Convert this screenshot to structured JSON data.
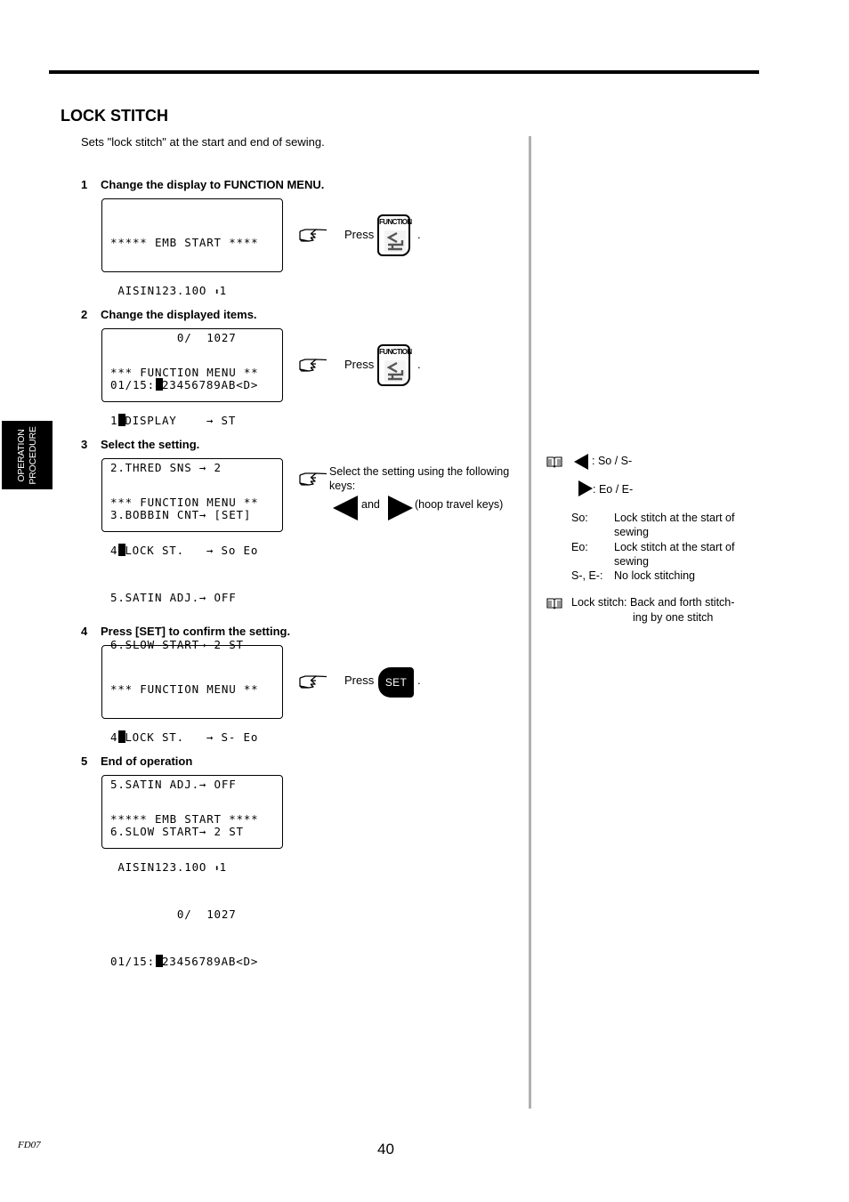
{
  "page": {
    "title": "LOCK STITCH",
    "intro": "Sets \"lock stitch\" at the start and end of sewing.",
    "side_tab": [
      "OPERATION",
      "PROCEDURE"
    ],
    "footer_code": "FD07",
    "page_number": "40"
  },
  "steps": [
    {
      "num": "1",
      "heading": "Change the display to FUNCTION MENU.",
      "lcd": {
        "line1": "***** EMB START ****",
        "line2_pre": " AISIN123.10O ",
        "line2_icon": "⬍",
        "line2_post": "1",
        "line3": "         0/  1027",
        "line4_pre": "01/15:",
        "line4_post": "23456789AB<D>"
      },
      "action_text": "Press",
      "key": "FUNCTION",
      "dot": "."
    },
    {
      "num": "2",
      "heading": "Change the displayed items.",
      "lcd": {
        "line1": "*** FUNCTION MENU **",
        "line2_pre": "1",
        "line2_post": "DISPLAY    → ST",
        "line3": "2.THRED SNS → 2",
        "line4": "3.BOBBIN CNT→ [SET]"
      },
      "action_text": "Press",
      "key": "FUNCTION",
      "dot": "."
    },
    {
      "num": "3",
      "heading": "Select the setting.",
      "lcd": {
        "line1": "*** FUNCTION MENU **",
        "line2_pre": "4",
        "line2_post": "LOCK ST.   → So Eo",
        "line3": "5.SATIN ADJ.→ OFF",
        "line4": "6.SLOW START→ 2 ST"
      },
      "action_text": "Select the setting using the following keys:",
      "and_text": "and",
      "keys_note": "(hoop travel keys)"
    },
    {
      "num": "4",
      "heading": "Press [SET] to confirm the setting.",
      "lcd": {
        "line1": "*** FUNCTION MENU **",
        "line2_pre": "4",
        "line2_post": "LOCK ST.   → S- Eo",
        "line3": "5.SATIN ADJ.→ OFF",
        "line4": "6.SLOW START→ 2 ST"
      },
      "action_text": "Press",
      "key": "SET",
      "dot": "."
    },
    {
      "num": "5",
      "heading": "End of operation",
      "lcd": {
        "line1": "***** EMB START ****",
        "line2_pre": " AISIN123.10O ",
        "line2_icon": "⬍",
        "line2_post": "1",
        "line3": "         0/  1027",
        "line4_pre": "01/15:",
        "line4_post": "23456789AB<D>"
      }
    }
  ],
  "notes": {
    "left_key_text": ": So / S-",
    "right_key_text": ": Eo / E-",
    "definitions": [
      {
        "term": "So:",
        "def": "Lock stitch at the start of sewing"
      },
      {
        "term": "Eo:",
        "def": "Lock stitch at the start of sewing"
      },
      {
        "term": "S-, E-:",
        "def": "No lock stitching"
      }
    ],
    "lock_stitch_line1": "Lock stitch: Back and forth stitch-",
    "lock_stitch_line2": "ing by one stitch"
  }
}
